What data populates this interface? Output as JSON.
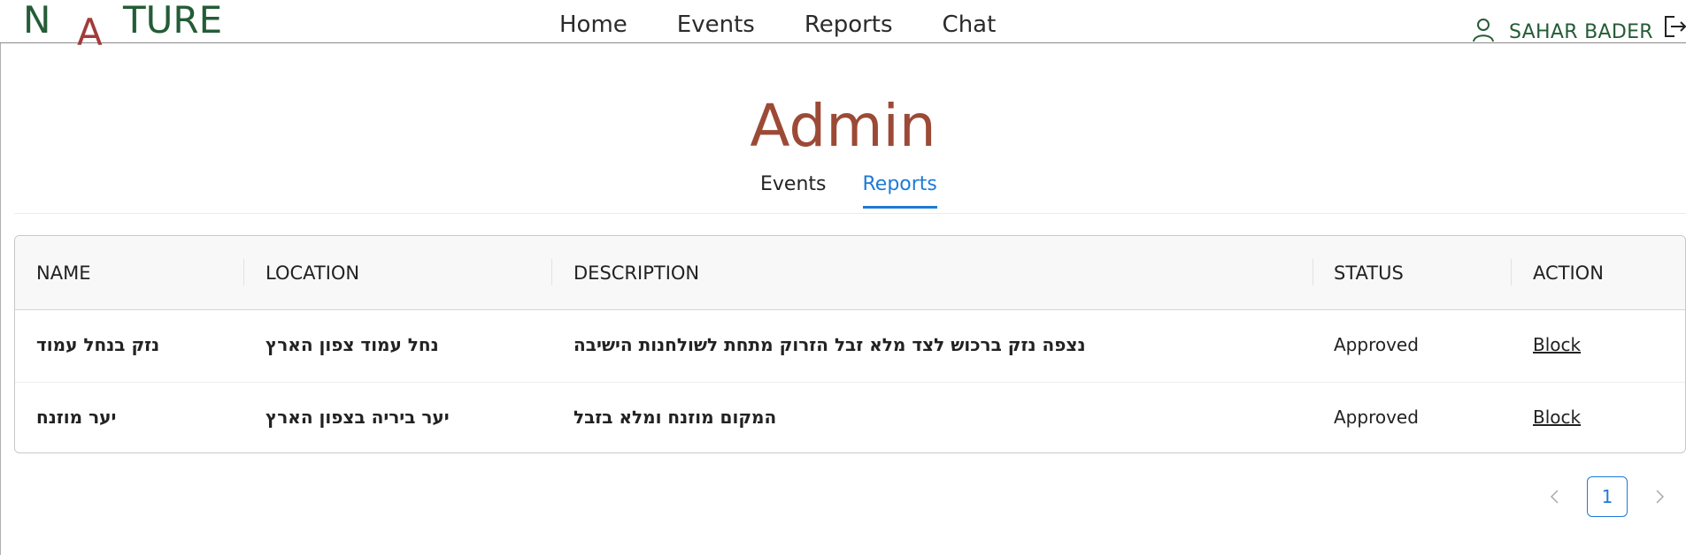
{
  "brand": {
    "part1": "N",
    "part2": "A",
    "part3": "TURE"
  },
  "nav": [
    {
      "label": "Home"
    },
    {
      "label": "Events"
    },
    {
      "label": "Reports"
    },
    {
      "label": "Chat"
    }
  ],
  "user": {
    "name": "SAHAR BADER"
  },
  "icons": {
    "user": "user-icon",
    "logout": "logout-icon",
    "prev": "chevron-left-icon",
    "next": "chevron-right-icon"
  },
  "colors": {
    "brand_green": "#245c36",
    "brand_red": "#a33a3a",
    "title": "#9c4a36",
    "accent": "#1f7ad6"
  },
  "page": {
    "title": "Admin"
  },
  "tabs": [
    {
      "label": "Events",
      "active": false
    },
    {
      "label": "Reports",
      "active": true
    }
  ],
  "table": {
    "headers": [
      "NAME",
      "LOCATION",
      "DESCRIPTION",
      "STATUS",
      "ACTION"
    ],
    "rows": [
      {
        "name": "נזק בנחל עמוד",
        "location": "נחל עמוד צפון הארץ",
        "description": "נצפה נזק ברכוש לצד מלא זבל הזרוק מתחת לשולחנות הישיבה",
        "status": "Approved",
        "action": "Block"
      },
      {
        "name": "יער מוזנח",
        "location": "יער ביריה בצפון הארץ",
        "description": "המקום מוזנח ומלא בזבל",
        "status": "Approved",
        "action": "Block"
      }
    ]
  },
  "pagination": {
    "current": "1"
  }
}
